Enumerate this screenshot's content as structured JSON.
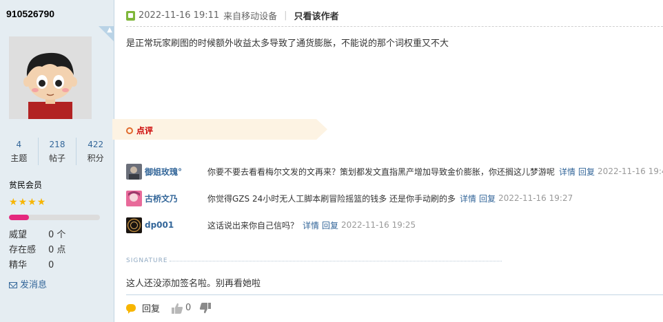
{
  "user": {
    "username": "910526790",
    "stats": [
      {
        "value": "4",
        "label": "主题"
      },
      {
        "value": "218",
        "label": "帖子"
      },
      {
        "value": "422",
        "label": "积分"
      }
    ],
    "rank": "贫民会员",
    "rank_progress": 0.22,
    "attributes": [
      {
        "key": "威望",
        "value": "0 个"
      },
      {
        "key": "存在感",
        "value": "0 点"
      },
      {
        "key": "精华",
        "value": "0"
      }
    ],
    "message_label": "发消息"
  },
  "post": {
    "datetime": "2022-11-16 19:11",
    "source": "来自移动设备",
    "separator": "|",
    "author_only": "只看该作者",
    "content": "是正常玩家刷图的时候额外收益太多导致了通货膨胀，不能说的那个词权重又不大"
  },
  "ratings": {
    "title": "点评",
    "comments": [
      {
        "name": "御姐玫瑰°",
        "text": "你要不要去看看梅尔文发的文再来？策划都发文直指黑产增加导致金价膨胀，你还搁这儿梦游呢",
        "detail": "详情",
        "reply": "回复",
        "time": "2022-11-16 19:4"
      },
      {
        "name": "古桥文乃",
        "text": "你觉得GZS 24小时无人工脚本刷冒险摇篮的钱多 还是你手动刷的多",
        "detail": "详情",
        "reply": "回复",
        "time": "2022-11-16 19:27"
      },
      {
        "name": "dp001",
        "text": "这话说出来你自己信吗？",
        "detail": "详情",
        "reply": "回复",
        "time": "2022-11-16 19:25"
      }
    ]
  },
  "signature": {
    "label": "SIGNATURE",
    "text": "这人还没添加签名啦。别再看她啦"
  },
  "footer": {
    "reply_label": "回复",
    "like_count": "0"
  },
  "colors": {
    "sidebar_bg": "#e5edf2",
    "link": "#336699",
    "rate_accent": "#cc0000",
    "progress": "#e4287d",
    "stars": "#f7b500"
  }
}
